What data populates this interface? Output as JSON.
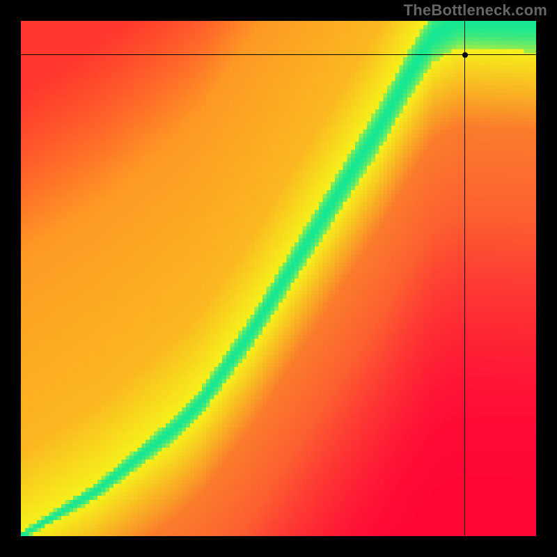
{
  "attribution": "TheBottleneck.com",
  "chart_data": {
    "type": "heatmap",
    "title": "",
    "xlabel": "",
    "ylabel": "",
    "xlim": [
      0,
      1
    ],
    "ylim": [
      0,
      1
    ],
    "grid": false,
    "pixel_grid": 128,
    "optimal_curve": {
      "description": "Green optimal ridge y = f(x); piecewise shape with steeper low end",
      "points": [
        {
          "x": 0.0,
          "y": 0.0
        },
        {
          "x": 0.05,
          "y": 0.03
        },
        {
          "x": 0.1,
          "y": 0.06
        },
        {
          "x": 0.15,
          "y": 0.09
        },
        {
          "x": 0.2,
          "y": 0.13
        },
        {
          "x": 0.25,
          "y": 0.17
        },
        {
          "x": 0.3,
          "y": 0.21
        },
        {
          "x": 0.35,
          "y": 0.26
        },
        {
          "x": 0.4,
          "y": 0.33
        },
        {
          "x": 0.45,
          "y": 0.4
        },
        {
          "x": 0.5,
          "y": 0.48
        },
        {
          "x": 0.55,
          "y": 0.56
        },
        {
          "x": 0.6,
          "y": 0.64
        },
        {
          "x": 0.65,
          "y": 0.72
        },
        {
          "x": 0.7,
          "y": 0.8
        },
        {
          "x": 0.75,
          "y": 0.89
        },
        {
          "x": 0.8,
          "y": 0.97
        },
        {
          "x": 0.85,
          "y": 1.0
        },
        {
          "x": 0.9,
          "y": 1.0
        },
        {
          "x": 0.95,
          "y": 1.0
        },
        {
          "x": 1.0,
          "y": 1.0
        }
      ]
    },
    "ridge_halfwidth": {
      "start": 0.008,
      "end": 0.06
    },
    "marker": {
      "x": 0.862,
      "y": 0.934
    },
    "colors": {
      "optimal": "#16e792",
      "near": "#f6f01a",
      "far_upper": "#ff8a26",
      "far_lower": "#ff1c3a"
    }
  }
}
